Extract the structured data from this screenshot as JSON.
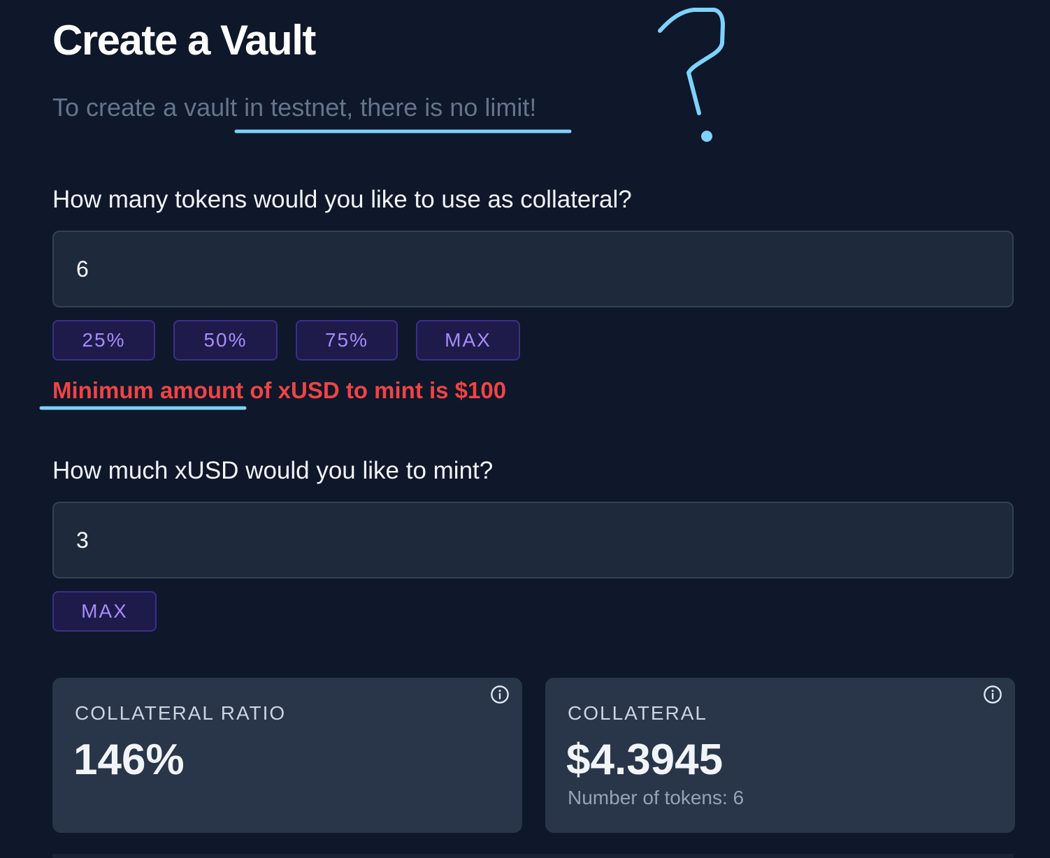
{
  "header": {
    "title": "Create a Vault",
    "subtitle": "To create a vault in testnet, there is no limit!"
  },
  "collateral": {
    "question": "How many tokens would you like to use as collateral?",
    "value": "6",
    "quick_buttons": [
      "25%",
      "50%",
      "75%",
      "MAX"
    ],
    "error": "Minimum amount of xUSD to mint is $100"
  },
  "mint": {
    "question": "How much xUSD would you like to mint?",
    "value": "3",
    "max_label": "MAX"
  },
  "cards": {
    "ratio": {
      "label": "COLLATERAL RATIO",
      "value": "146%"
    },
    "collateral": {
      "label": "COLLATERAL",
      "value": "$4.3945",
      "sub": "Number of tokens: 6"
    }
  },
  "colors": {
    "background": "#0f172a",
    "input_bg": "#1e293b",
    "card_bg": "#293548",
    "button_bg": "#1e1b4b",
    "button_text": "#a78bfa",
    "error": "#ef4444",
    "annotation": "#7dd3fc"
  },
  "icons": {
    "info": "info-circle-icon"
  }
}
